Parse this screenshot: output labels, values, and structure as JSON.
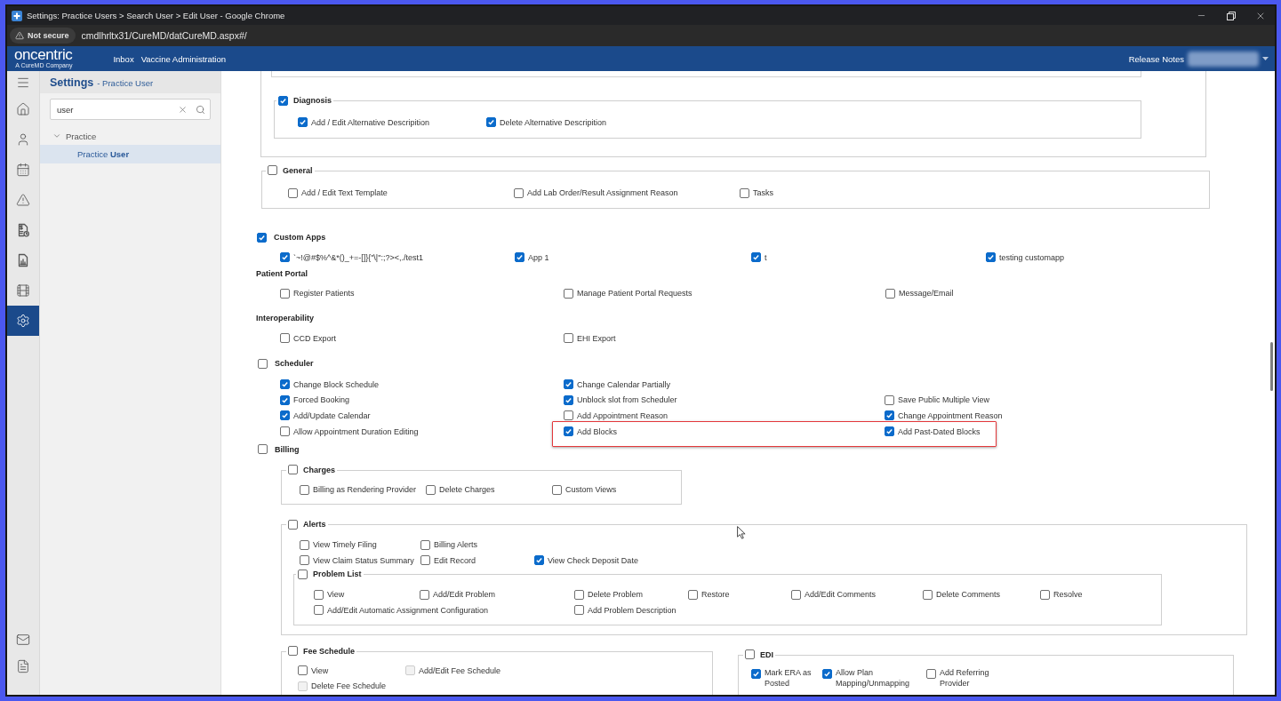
{
  "browser": {
    "title": "Settings: Practice Users > Search User > Edit User - Google Chrome",
    "security_label": "Not secure",
    "url": "cmdlhrltx31/CureMD/datCureMD.aspx#/"
  },
  "app_header": {
    "logo": "oncentric",
    "logo_tagline": "A CureMD Company",
    "nav": [
      {
        "label": "Inbox"
      },
      {
        "label": "Vaccine Administration"
      }
    ],
    "release_notes": "Release Notes"
  },
  "icon_rail": {
    "items": [
      {
        "kind": "menu",
        "selected": false
      },
      {
        "kind": "home",
        "selected": false
      },
      {
        "kind": "user",
        "selected": false
      },
      {
        "kind": "calendar",
        "selected": false
      },
      {
        "kind": "alert",
        "selected": false
      },
      {
        "kind": "billing_document",
        "selected": false
      },
      {
        "kind": "report",
        "selected": false
      },
      {
        "kind": "media",
        "selected": false
      },
      {
        "kind": "settings",
        "selected": true
      }
    ],
    "bottom_items": [
      {
        "kind": "mail",
        "selected": false
      },
      {
        "kind": "notes",
        "selected": false
      }
    ]
  },
  "settings_panel": {
    "title": "Settings",
    "subtitle": "- Practice User",
    "search": {
      "value": "user"
    },
    "tree": [
      {
        "label": "Practice",
        "expanded": true,
        "selected": false,
        "children": [
          {
            "label": "Practice **User**",
            "selected": true
          }
        ]
      }
    ]
  },
  "permissions": [
    {
      "kind": "box",
      "groups": [
        {
          "kind": "group",
          "title": "Diagnosis",
          "checked": true,
          "rows": [
            {
              "items": [
                {
                  "label": "Add / Edit Alternative Descripition",
                  "checked": true
                },
                {
                  "label": "Delete Alternative Descripition",
                  "checked": true
                }
              ]
            }
          ]
        }
      ]
    },
    {
      "kind": "group",
      "title": "General",
      "checked": false,
      "rows": [
        {
          "items": [
            {
              "label": "Add / Edit Text Template",
              "checked": false
            },
            {
              "label": "Add Lab Order/Result Assignment Reason",
              "checked": false
            },
            {
              "label": "Tasks",
              "checked": false
            }
          ]
        }
      ]
    },
    {
      "kind": "section",
      "title": "Custom Apps",
      "checked": true,
      "rows": [
        {
          "items": [
            {
              "label": "`~!@#$%^&*()_+=-[]}{\"\\|\":;?><,./test1",
              "checked": true
            },
            {
              "label": "App 1",
              "checked": true
            },
            {
              "label": "t",
              "checked": true
            },
            {
              "label": "testing customapp",
              "checked": true
            }
          ]
        }
      ]
    },
    {
      "kind": "heading",
      "title": "Patient Portal",
      "rows": [
        {
          "items": [
            {
              "label": "Register Patients",
              "checked": false
            },
            {
              "label": "Manage Patient Portal Requests",
              "checked": false
            },
            {
              "label": "Message/Email",
              "checked": false
            }
          ]
        }
      ]
    },
    {
      "kind": "heading",
      "title": "Interoperability",
      "rows": [
        {
          "items": [
            {
              "label": "CCD Export",
              "checked": false
            },
            {
              "label": "EHI Export",
              "checked": false
            }
          ]
        }
      ]
    },
    {
      "kind": "section",
      "title": "Scheduler",
      "checked": false,
      "rows": [
        {
          "items": [
            {
              "label": "Change Block Schedule",
              "checked": true,
              "highlighted": false
            },
            {
              "label": "Change Calendar Partially",
              "checked": true,
              "highlighted": false
            }
          ]
        },
        {
          "items": [
            {
              "label": "Forced Booking",
              "checked": true,
              "highlighted": false
            },
            {
              "label": "Unblock slot from Scheduler",
              "checked": true,
              "highlighted": false
            },
            {
              "label": "Save Public Multiple View",
              "checked": false,
              "highlighted": false
            }
          ]
        },
        {
          "items": [
            {
              "label": "Add/Update Calendar",
              "checked": true,
              "highlighted": false
            },
            {
              "label": "Add Appointment Reason",
              "checked": false,
              "highlighted": false
            },
            {
              "label": "Change Appointment Reason",
              "checked": true,
              "highlighted": false
            }
          ]
        },
        {
          "items": [
            {
              "label": "Allow Appointment Duration Editing",
              "checked": false,
              "highlighted": false
            },
            {
              "label": "Add Blocks",
              "checked": true,
              "highlighted": true
            },
            {
              "label": "Add Past-Dated Blocks",
              "checked": true,
              "highlighted": true
            }
          ]
        }
      ]
    },
    {
      "kind": "section",
      "title": "Billing",
      "checked": false,
      "groups": [
        {
          "kind": "group",
          "title": "Charges",
          "checked": false,
          "rows": [
            {
              "items": [
                {
                  "label": "Billing as Rendering Provider",
                  "checked": false
                },
                {
                  "label": "Delete Charges",
                  "checked": false
                },
                {
                  "label": "Custom Views",
                  "checked": false
                }
              ]
            }
          ]
        },
        {
          "kind": "group",
          "title": "Alerts",
          "checked": false,
          "rows": [
            {
              "items": [
                {
                  "label": "View Timely Filing",
                  "checked": false
                },
                {
                  "label": "Billing Alerts",
                  "checked": false
                }
              ]
            },
            {
              "items": [
                {
                  "label": "View Claim Status Summary",
                  "checked": false
                },
                {
                  "label": "Edit Record",
                  "checked": false
                },
                {
                  "label": "View Check Deposit Date",
                  "checked": true
                }
              ]
            }
          ],
          "groups": [
            {
              "kind": "group",
              "title": "Problem List",
              "checked": false,
              "rows": [
                {
                  "items": [
                    {
                      "label": "View",
                      "checked": false
                    },
                    {
                      "label": "Add/Edit Problem",
                      "checked": false
                    },
                    {
                      "label": "Delete Problem",
                      "checked": false
                    },
                    {
                      "label": "Restore",
                      "checked": false
                    },
                    {
                      "label": "Add/Edit Comments",
                      "checked": false
                    },
                    {
                      "label": "Delete Comments",
                      "checked": false
                    },
                    {
                      "label": "Resolve",
                      "checked": false
                    }
                  ]
                },
                {
                  "items": [
                    {
                      "label": "Add/Edit Automatic Assignment Configuration",
                      "checked": false
                    },
                    {
                      "label": "Add Problem Description",
                      "checked": false
                    }
                  ]
                }
              ]
            }
          ]
        },
        {
          "kind": "group",
          "title": "Fee Schedule",
          "checked": false,
          "rows": [
            {
              "items": [
                {
                  "label": "View",
                  "checked": false,
                  "disabled": false
                },
                {
                  "label": "Add/Edit Fee Schedule",
                  "checked": false,
                  "disabled": true
                }
              ]
            },
            {
              "items": [
                {
                  "label": "Delete Fee Schedule",
                  "checked": false,
                  "disabled": true
                }
              ]
            }
          ]
        },
        {
          "kind": "group",
          "title": "EDI",
          "checked": false,
          "rows": [
            {
              "items": [
                {
                  "label": "Mark ERA as Posted",
                  "checked": true
                },
                {
                  "label": "Allow Plan Mapping/Unmapping",
                  "checked": true
                },
                {
                  "label": "Add Referring Provider",
                  "checked": false
                }
              ]
            }
          ]
        }
      ]
    }
  ]
}
